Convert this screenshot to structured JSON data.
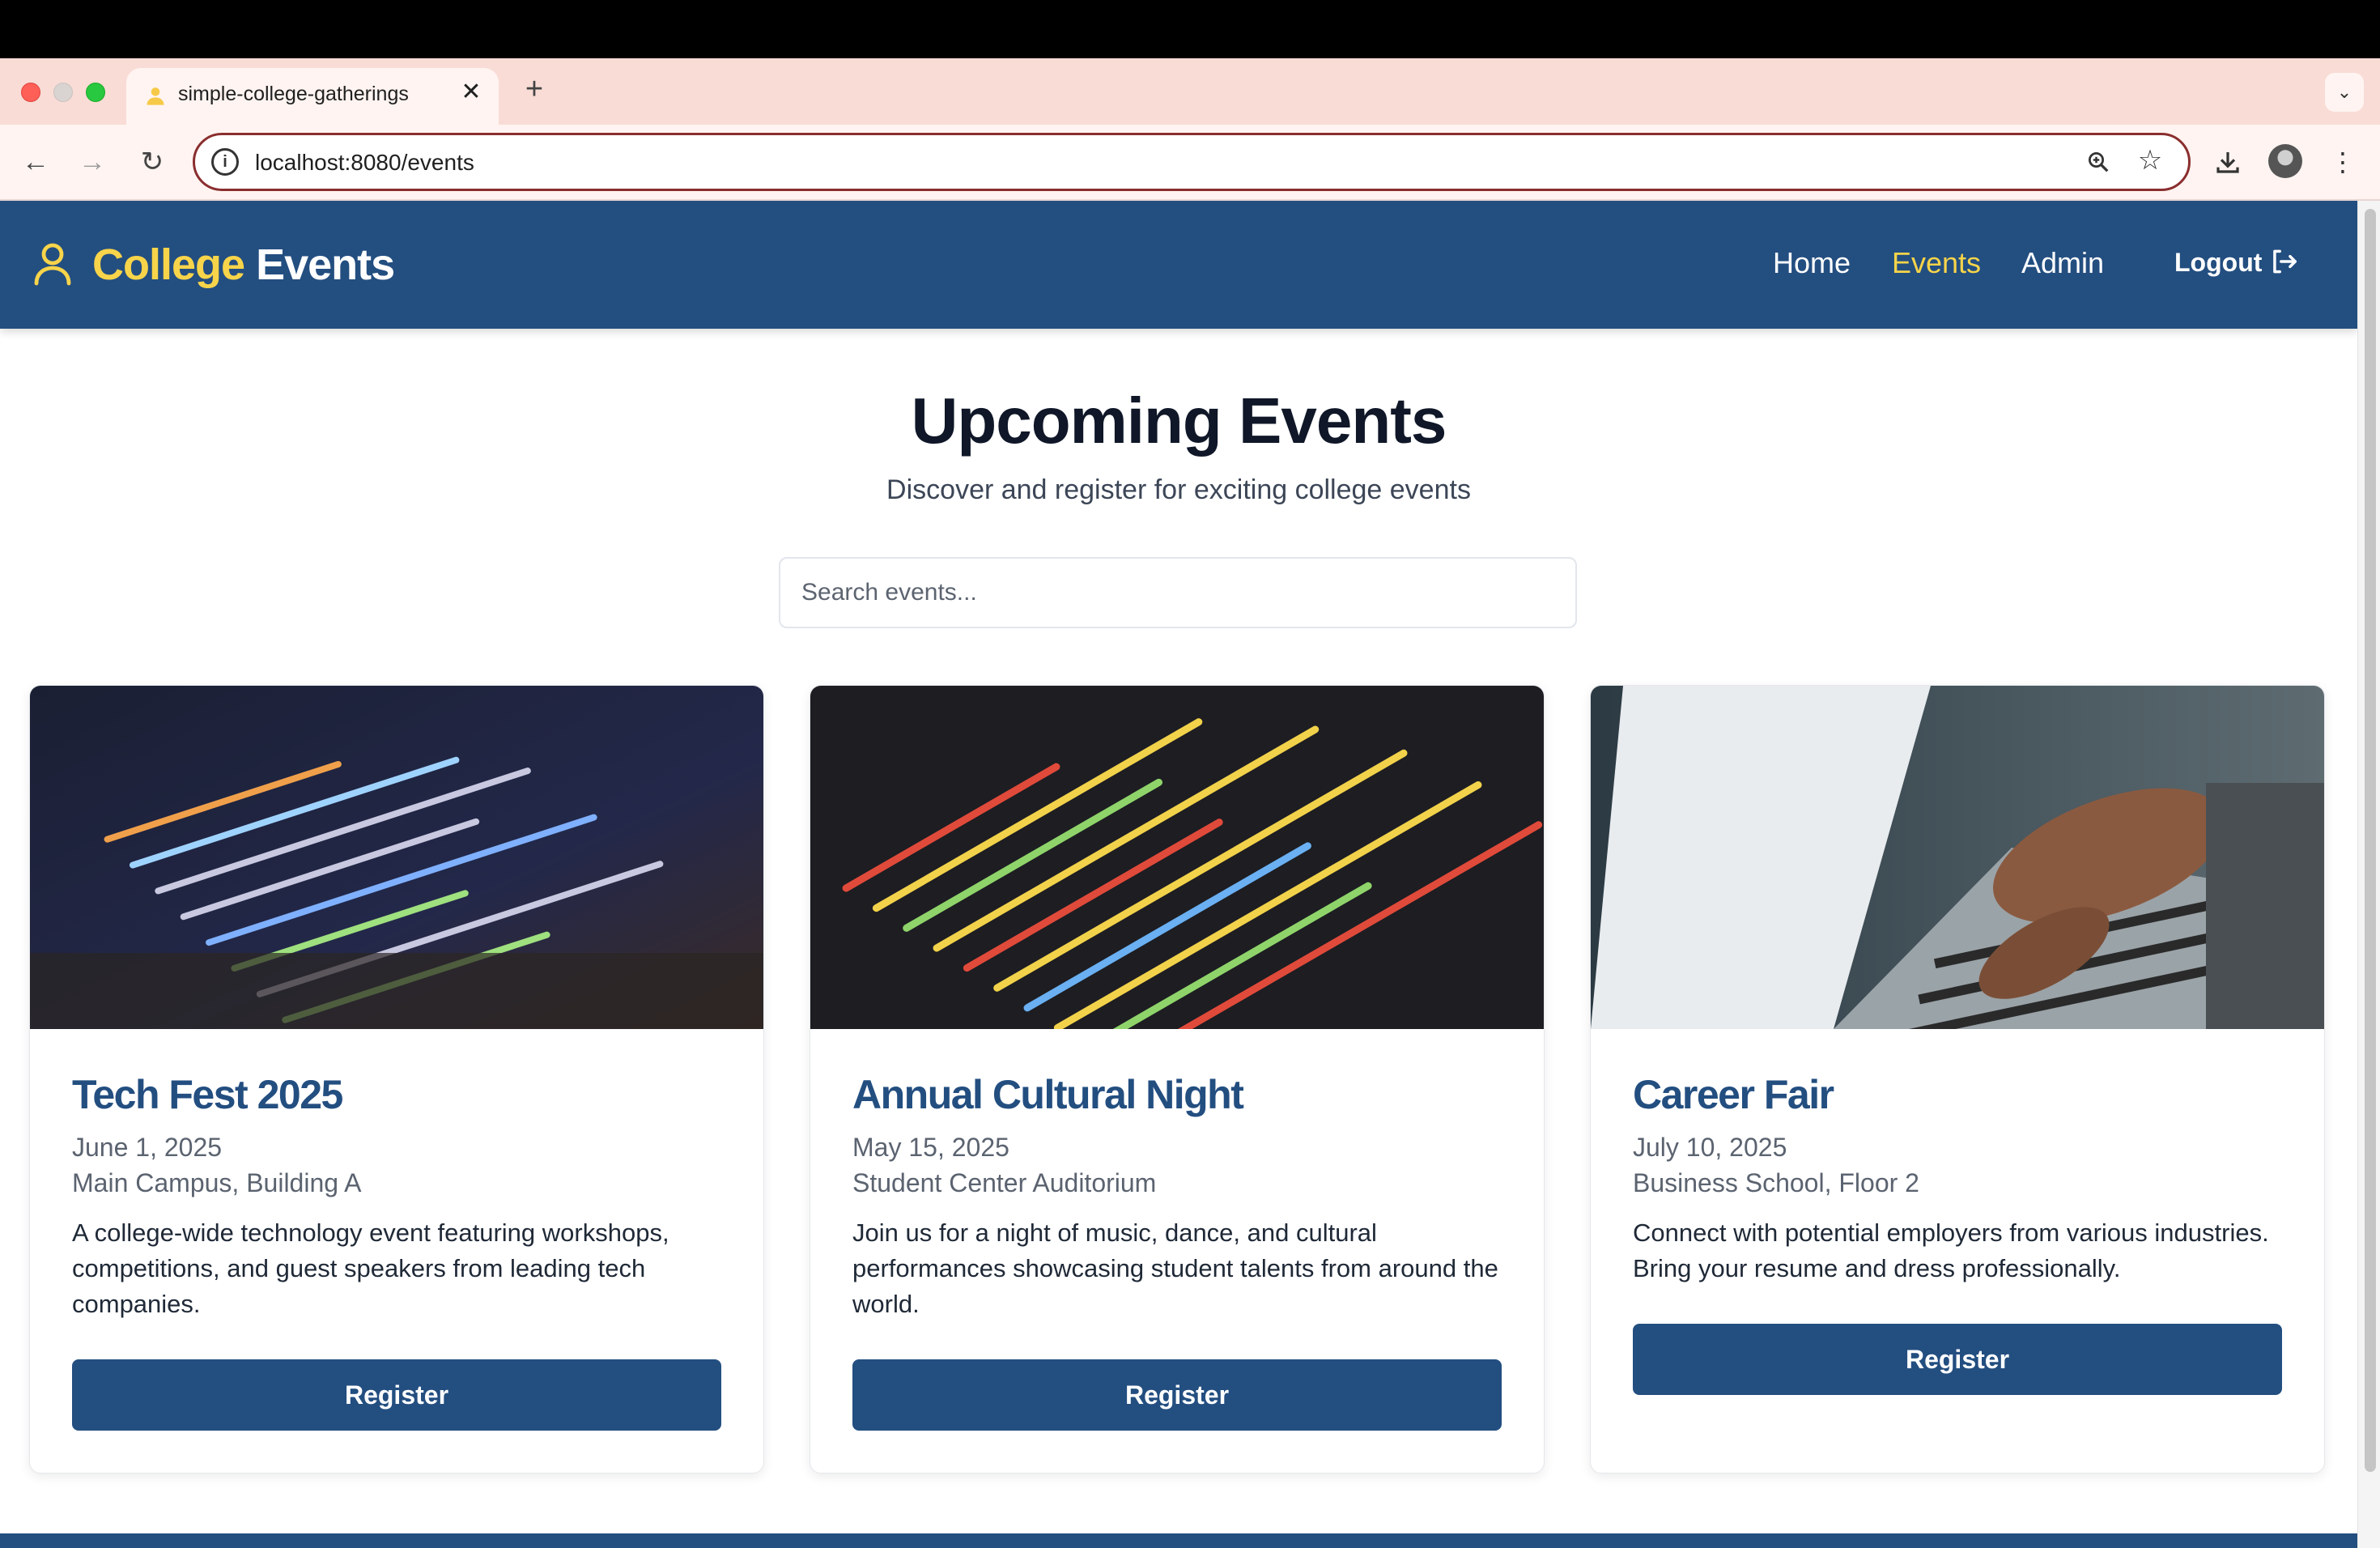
{
  "browser": {
    "tab_title": "simple-college-gatherings",
    "tab_close": "✕",
    "new_tab": "+",
    "url": "localhost:8080/events"
  },
  "header": {
    "brand_part1": "College",
    "brand_part2": "Events",
    "nav": [
      {
        "label": "Home",
        "active": false
      },
      {
        "label": "Events",
        "active": true
      },
      {
        "label": "Admin",
        "active": false
      }
    ],
    "logout_label": "Logout",
    "accent_color": "#f7d44a",
    "brand_color": "#234e80"
  },
  "main": {
    "title": "Upcoming Events",
    "subtitle": "Discover and register for exciting college events",
    "search_placeholder": "Search events..."
  },
  "events": [
    {
      "title": "Tech Fest 2025",
      "date": "June 1, 2025",
      "location": "Main Campus, Building A",
      "description": "A college-wide technology event featuring workshops, competitions, and guest speakers from leading tech companies.",
      "button": "Register",
      "image": "code-on-laptop-screen"
    },
    {
      "title": "Annual Cultural Night",
      "date": "May 15, 2025",
      "location": "Student Center Auditorium",
      "description": "Join us for a night of music, dance, and cultural performances showcasing student talents from around the world.",
      "button": "Register",
      "image": "code-editor-screen"
    },
    {
      "title": "Career Fair",
      "date": "July 10, 2025",
      "location": "Business School, Floor 2",
      "description": "Connect with potential employers from various industries. Bring your resume and dress professionally.",
      "button": "Register",
      "image": "hands-typing-on-laptop"
    }
  ]
}
